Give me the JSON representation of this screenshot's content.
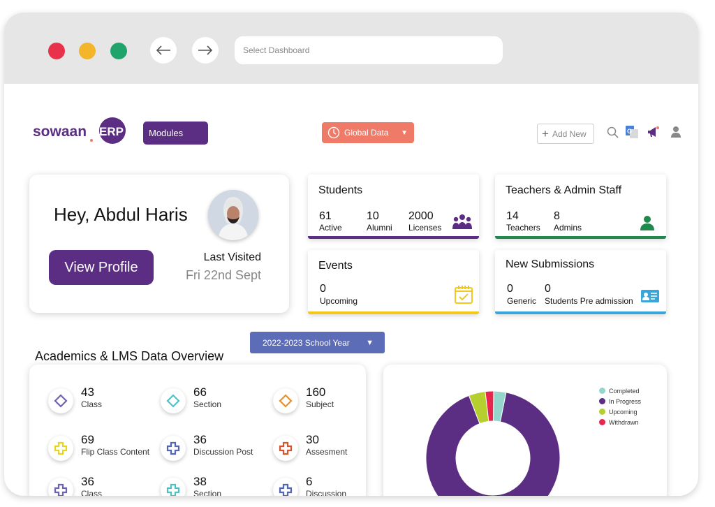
{
  "browser": {
    "url_placeholder": "Select Dashboard"
  },
  "header": {
    "logo_text": "sowaanERP",
    "modules_label": "Modules",
    "global_label": "Global Data",
    "add_new_label": "Add New"
  },
  "welcome": {
    "greeting": "Hey, Abdul Haris",
    "view_profile_label": "View Profile",
    "last_visited_label": "Last Visited",
    "last_visited_date": "Fri 22nd Sept"
  },
  "students": {
    "title": "Students",
    "stats": [
      {
        "value": "61",
        "label": "Active"
      },
      {
        "value": "10",
        "label": "Alumni"
      },
      {
        "value": "2000",
        "label": "Licenses"
      }
    ]
  },
  "staff": {
    "title": "Teachers & Admin Staff",
    "stats": [
      {
        "value": "14",
        "label": "Teachers"
      },
      {
        "value": "8",
        "label": "Admins"
      }
    ]
  },
  "events": {
    "title": "Events",
    "stats": [
      {
        "value": "0",
        "label": "Upcoming"
      }
    ]
  },
  "submissions": {
    "title": "New Submissions",
    "stats": [
      {
        "value": "0",
        "label": "Generic"
      },
      {
        "value": "0",
        "label": "Students Pre admission"
      }
    ]
  },
  "academics": {
    "title": "Academics & LMS Data Overview",
    "year_label": "2022-2023 School Year",
    "items": [
      {
        "value": "43",
        "label": "Class"
      },
      {
        "value": "66",
        "label": "Section"
      },
      {
        "value": "160",
        "label": "Subject"
      },
      {
        "value": "69",
        "label": "Flip Class Content"
      },
      {
        "value": "36",
        "label": "Discussion Post"
      },
      {
        "value": "30",
        "label": "Assesment"
      },
      {
        "value": "36",
        "label": "Class"
      },
      {
        "value": "38",
        "label": "Section"
      },
      {
        "value": "6",
        "label": "Discussion"
      }
    ]
  },
  "chart_data": {
    "type": "pie",
    "categories": [
      "Completed",
      "In Progress",
      "Upcoming",
      "Withdrawn"
    ],
    "values": [
      3,
      91,
      4,
      2
    ],
    "colors": [
      "#95d6cc",
      "#5b2d83",
      "#b5cf2e",
      "#e8254d"
    ]
  },
  "colors": {
    "brand_purple": "#5b2d83",
    "students_bar": "#5b2d83",
    "staff_bar": "#1f8a4c",
    "events_bar": "#f2c81b",
    "submissions_bar": "#3aa5d8",
    "global_btn": "#ef7a68",
    "year_btn": "#5c6cb6"
  }
}
